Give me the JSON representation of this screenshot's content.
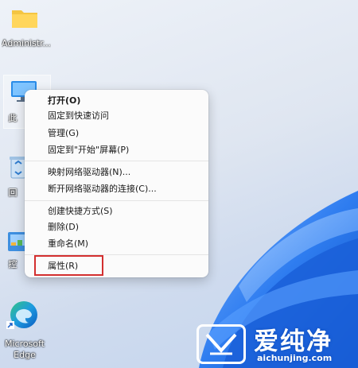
{
  "desktop": {
    "icons": [
      {
        "label": "Administr...",
        "icon": "folder-icon"
      },
      {
        "label": "此",
        "icon": "this-pc-icon"
      },
      {
        "label": "回",
        "icon": "recycle-bin-icon"
      },
      {
        "label": "控",
        "icon": "control-panel-icon"
      },
      {
        "label_line1": "Microsoft",
        "label_line2": "Edge",
        "icon": "edge-icon"
      }
    ]
  },
  "context_menu": {
    "items": [
      "打开(O)",
      "固定到快速访问",
      "管理(G)",
      "固定到\"开始\"屏幕(P)",
      "映射网络驱动器(N)...",
      "断开网络驱动器的连接(C)...",
      "创建快捷方式(S)",
      "删除(D)",
      "重命名(M)",
      "属性(R)"
    ],
    "highlighted_item": "属性(R)",
    "highlight_color": "#d32f2f"
  },
  "watermark": {
    "title": "爱纯净",
    "url": "aichunjing.com"
  },
  "colors": {
    "wallpaper_blue": "#1f6fe0",
    "menu_bg": "#fbfbfb"
  }
}
